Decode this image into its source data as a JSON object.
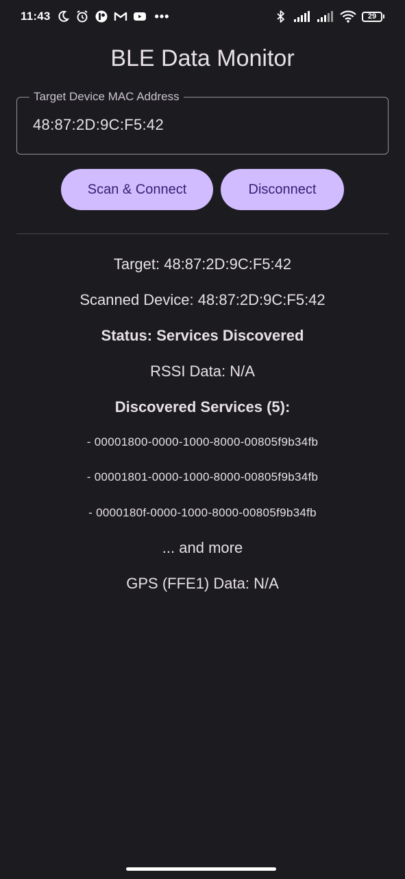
{
  "status_bar": {
    "time": "11:43",
    "left_icons": [
      "moon-icon",
      "alarm-icon",
      "app-notification-icon",
      "gmail-icon",
      "youtube-icon"
    ],
    "overflow": "•••",
    "right_icons": [
      "bluetooth-icon",
      "signal-icon",
      "signal-icon",
      "wifi-icon"
    ],
    "battery": "29"
  },
  "app": {
    "title": "BLE Data Monitor"
  },
  "mac_field": {
    "label": "Target Device MAC Address",
    "value": "48:87:2D:9C:F5:42"
  },
  "buttons": {
    "scan_connect": "Scan & Connect",
    "disconnect": "Disconnect"
  },
  "info": {
    "target": "Target: 48:87:2D:9C:F5:42",
    "scanned": "Scanned Device: 48:87:2D:9C:F5:42",
    "status": "Status: Services Discovered",
    "rssi": "RSSI Data: N/A",
    "services_header": "Discovered Services (5):",
    "services": [
      "- 00001800-0000-1000-8000-00805f9b34fb",
      "- 00001801-0000-1000-8000-00805f9b34fb",
      "- 0000180f-0000-1000-8000-00805f9b34fb"
    ],
    "more": "... and more",
    "gps": "GPS (FFE1) Data: N/A"
  },
  "colors": {
    "background": "#1c1b1f",
    "button_fill": "#d0bcff",
    "button_text": "#381e72",
    "text": "#e6e1e5"
  }
}
